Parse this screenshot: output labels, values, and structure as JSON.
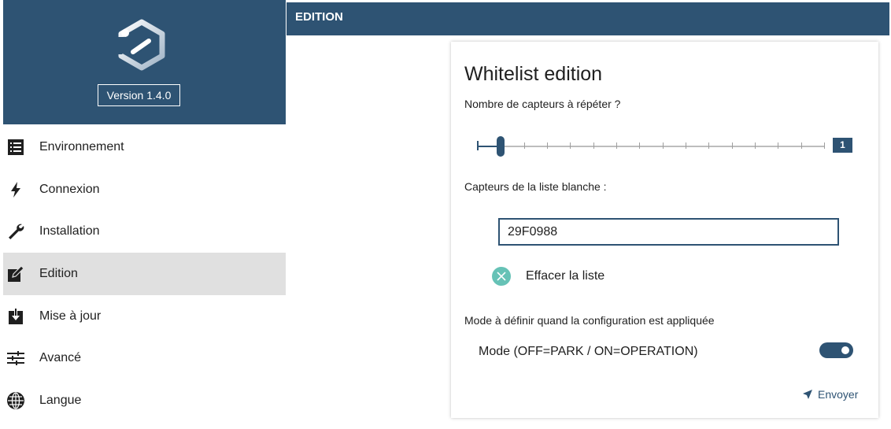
{
  "app": {
    "version_label": "Version 1.4.0"
  },
  "sidebar": {
    "items": [
      {
        "label": "Environnement",
        "icon": "list-icon",
        "active": false
      },
      {
        "label": "Connexion",
        "icon": "lightning-icon",
        "active": false
      },
      {
        "label": "Installation",
        "icon": "wrench-icon",
        "active": false
      },
      {
        "label": "Edition",
        "icon": "edit-icon",
        "active": true
      },
      {
        "label": "Mise à jour",
        "icon": "download-icon",
        "active": false
      },
      {
        "label": "Avancé",
        "icon": "sliders-icon",
        "active": false
      },
      {
        "label": "Langue",
        "icon": "globe-icon",
        "active": false
      }
    ]
  },
  "topbar": {
    "title": "EDITION"
  },
  "card": {
    "title": "Whitelist edition",
    "count_label": "Nombre de capteurs à répéter ?",
    "slider": {
      "value": "1",
      "min": 1,
      "max": 16
    },
    "list_label": "Capteurs de la liste blanche :",
    "list_value": "29F0988",
    "clear_label": "Effacer la liste",
    "mode_section_label": "Mode à définir quand la configuration est appliquée",
    "mode_toggle_label": "Mode (OFF=PARK / ON=OPERATION)",
    "mode_toggle_on": true,
    "send_label": "Envoyer"
  },
  "colors": {
    "brand": "#2e5373",
    "active_row": "#e0e0e0",
    "clear_icon": "#66c2b6"
  }
}
